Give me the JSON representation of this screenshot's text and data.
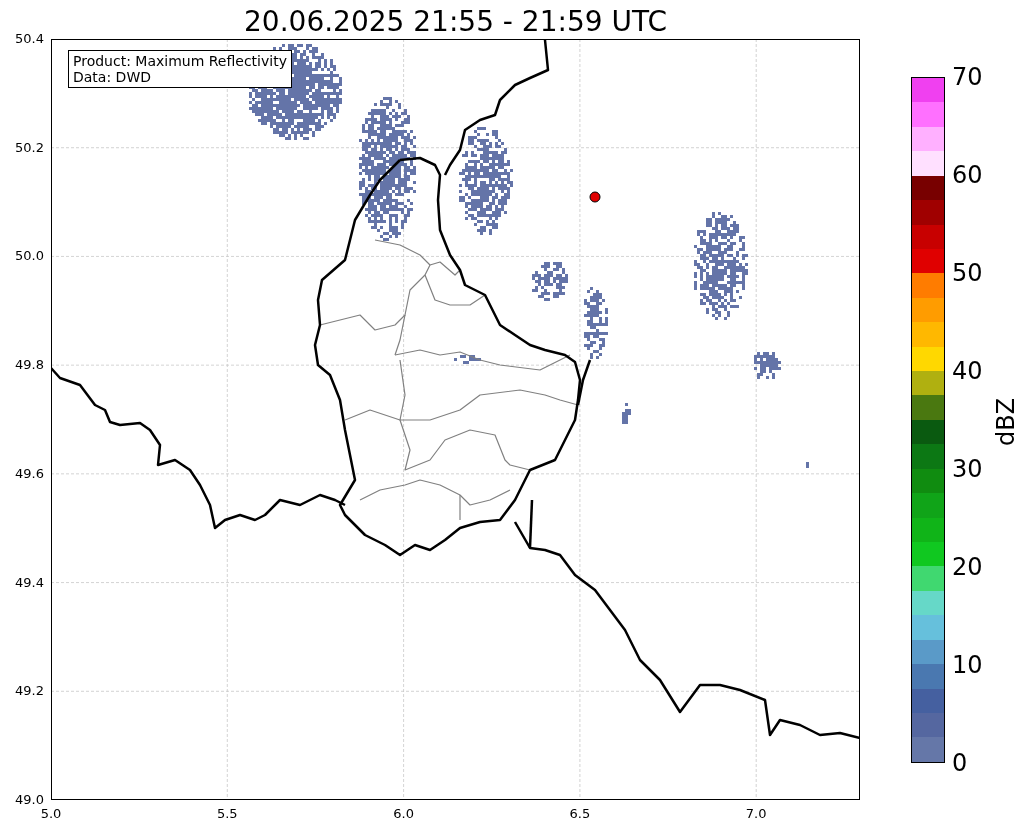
{
  "title": "20.06.2025 21:55 - 21:59 UTC",
  "map": {
    "legend": [
      "Product: Maximum Reflectivity",
      "Data: DWD"
    ],
    "x_tick_labels": [
      "5.0",
      "5.5",
      "6.0",
      "6.5",
      "7.0"
    ],
    "y_tick_labels": [
      "50.4",
      "50.2",
      "50.0",
      "49.8",
      "49.6",
      "49.4",
      "49.2",
      "49.0"
    ]
  },
  "colorbar": {
    "label": "dBZ",
    "tick_labels": [
      "70",
      "60",
      "50",
      "40",
      "30",
      "20",
      "10",
      "0"
    ],
    "segments": [
      {
        "color": "#f040f0"
      },
      {
        "color": "#ff70ff"
      },
      {
        "color": "#ffb0ff"
      },
      {
        "color": "#ffe0ff"
      },
      {
        "color": "#780000"
      },
      {
        "color": "#a00000"
      },
      {
        "color": "#c80000"
      },
      {
        "color": "#e00000"
      },
      {
        "color": "#ff7c00"
      },
      {
        "color": "#ff9c00"
      },
      {
        "color": "#ffb800"
      },
      {
        "color": "#ffd800"
      },
      {
        "color": "#b0b010"
      },
      {
        "color": "#4a7810"
      },
      {
        "color": "#0a5a10"
      },
      {
        "color": "#0c7814"
      },
      {
        "color": "#108c10"
      },
      {
        "color": "#10a418"
      },
      {
        "color": "#10b418"
      },
      {
        "color": "#10c820"
      },
      {
        "color": "#40d870"
      },
      {
        "color": "#66d8c8"
      },
      {
        "color": "#66c0dc"
      },
      {
        "color": "#5a9ac8"
      },
      {
        "color": "#4a78b0"
      },
      {
        "color": "#4560a0"
      },
      {
        "color": "#5567a0"
      },
      {
        "color": "#6577a8"
      }
    ]
  }
}
